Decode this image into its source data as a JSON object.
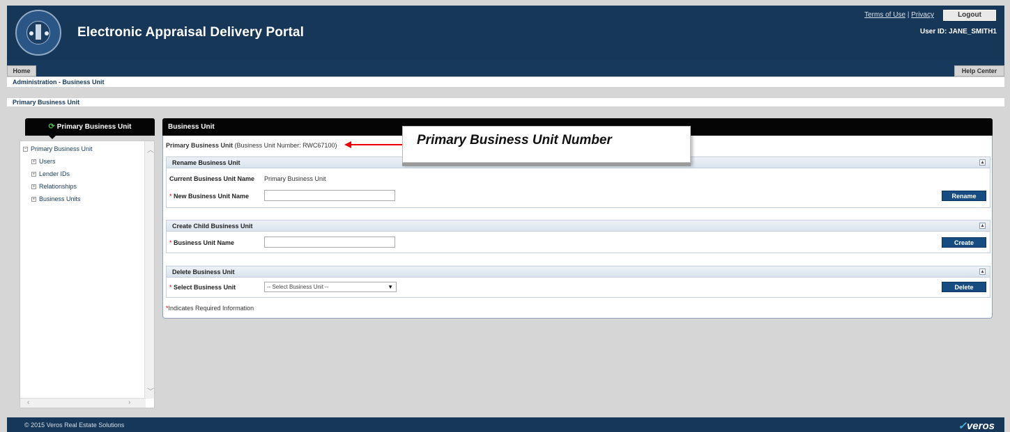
{
  "header": {
    "app_title": "Electronic Appraisal Delivery Portal",
    "terms_link": "Terms of Use",
    "separator": "|",
    "privacy_link": "Privacy",
    "logout_label": "Logout",
    "user_id": "User ID: JANE_SMITH1"
  },
  "tabs": {
    "home": "Home",
    "help_center": "Help Center"
  },
  "breadcrumb": "Administration - Business Unit",
  "page_title": "Primary Business Unit",
  "left_panel": {
    "title": "Primary Business Unit",
    "tree": {
      "root": "Primary Business Unit",
      "children": [
        "Users",
        "Lender IDs",
        "Relationships",
        "Business Units"
      ]
    }
  },
  "main": {
    "title": "Business Unit",
    "primary_name": "Primary Business Unit",
    "primary_number_text": "(Business Unit Number: RWC67100)",
    "rename": {
      "title": "Rename Business Unit",
      "current_label": "Current Business Unit Name",
      "current_value": "Primary Business Unit",
      "new_label": "New Business Unit Name",
      "new_value": "",
      "button": "Rename"
    },
    "create": {
      "title": "Create Child Business Unit",
      "name_label": "Business Unit Name",
      "name_value": "",
      "button": "Create"
    },
    "delete": {
      "title": "Delete Business Unit",
      "select_label": "Select Business Unit",
      "select_value": "-- Select Business Unit --",
      "button": "Delete"
    },
    "required_note": "Indicates Required Information",
    "required_mark": "*"
  },
  "callout": {
    "text": "Primary Business Unit Number",
    "arrow_color": "#e00000"
  },
  "footer": {
    "copyright": "© 2015 Veros Real Estate Solutions",
    "brand": "veros"
  },
  "icons": [
    "hud-seal-logo",
    "refresh-icon",
    "collapse-icon",
    "tree-expand-icon",
    "dropdown-caret-icon",
    "veros-logo"
  ],
  "colors": {
    "header_bg": "#163757",
    "button_bg": "#174c82",
    "panel_head_bg": "#050505",
    "required": "#cc0000"
  }
}
